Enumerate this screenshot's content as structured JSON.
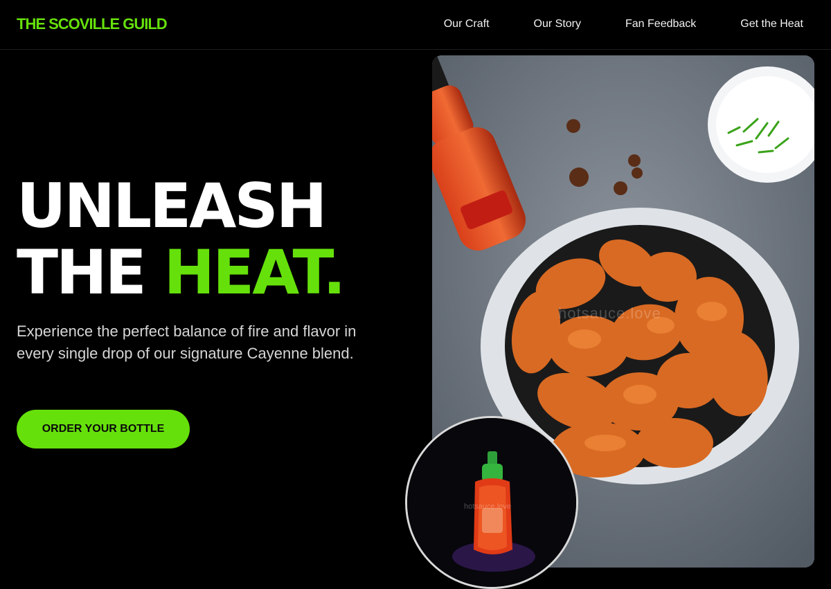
{
  "nav": {
    "brand": "THE SCOVILLE GUILD",
    "links": [
      "Our Craft",
      "Our Story",
      "Fan Feedback",
      "Get the Heat"
    ]
  },
  "hero": {
    "headline_line1": "UNLEASH",
    "headline_line2_white": "THE ",
    "headline_line2_accent": "HEAT.",
    "subtitle": "Experience the perfect balance of fire and flavor in every single drop of our signature Cayenne blend.",
    "cta_label": "ORDER YOUR BOTTLE"
  },
  "images": {
    "main_watermark": "hotsauce.love",
    "inset_watermark": "hotsauce.love"
  },
  "colors": {
    "accent": "#66e00b",
    "background": "#000000"
  }
}
